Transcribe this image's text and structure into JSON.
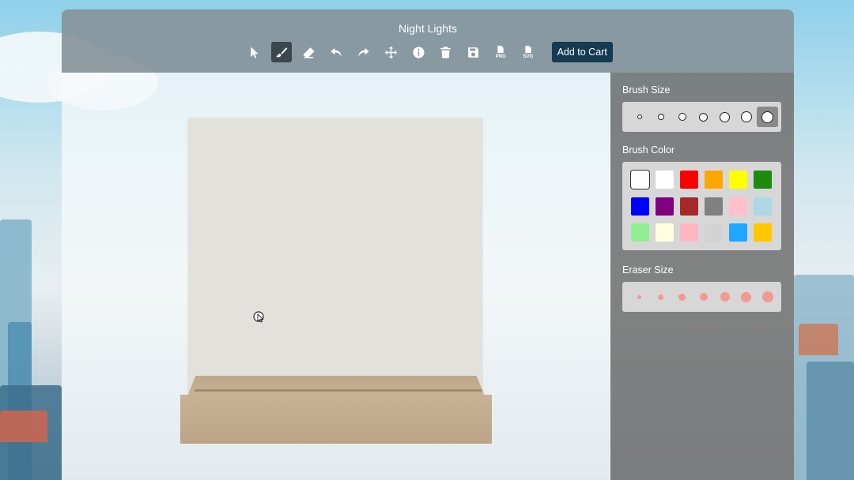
{
  "header": {
    "title": "Night Lights"
  },
  "toolbar": {
    "tools": [
      {
        "name": "select-tool",
        "icon": "pointer-icon"
      },
      {
        "name": "brush-tool",
        "icon": "brush-icon",
        "active": true
      },
      {
        "name": "eraser-tool",
        "icon": "eraser-icon"
      },
      {
        "name": "undo-tool",
        "icon": "undo-icon"
      },
      {
        "name": "redo-tool",
        "icon": "redo-icon"
      },
      {
        "name": "move-tool",
        "icon": "move-icon"
      },
      {
        "name": "info-tool",
        "icon": "info-icon"
      },
      {
        "name": "delete-tool",
        "icon": "trash-icon"
      },
      {
        "name": "save-tool",
        "icon": "save-icon"
      }
    ],
    "png_label": "PNG",
    "svg_label": "SVG",
    "cart_label": "Add to Cart"
  },
  "sidebar": {
    "brush_size_label": "Brush Size",
    "brush_sizes": [
      4,
      6,
      8,
      9,
      11,
      12,
      13
    ],
    "brush_size_selected_index": 6,
    "brush_color_label": "Brush Color",
    "brush_colors": [
      "#ffffff",
      "#ffffff",
      "#ff0000",
      "#ffa500",
      "#ffff00",
      "#1f8a10",
      "#0000ff",
      "#800080",
      "#a52a2a",
      "#808080",
      "#ffc0cb",
      "#add8e6",
      "#90ee90",
      "#ffffe0",
      "#ffb6c1",
      "#d3d3d3",
      "#1ea7ff",
      "#ffc700"
    ],
    "brush_color_selected_index": 0,
    "eraser_size_label": "Eraser Size",
    "eraser_sizes": [
      5,
      7,
      9,
      10,
      12,
      13,
      14
    ]
  },
  "colors": {
    "cart_button": "#153a52",
    "eraser_dot": "#f09a92"
  }
}
